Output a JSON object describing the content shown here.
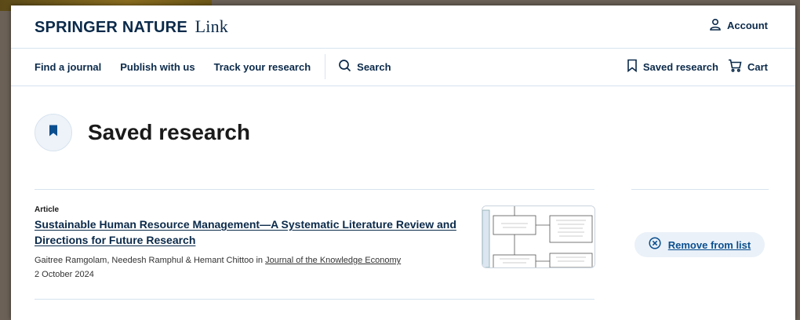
{
  "header": {
    "logo_brand": "SPRINGER NATURE",
    "logo_link": "Link",
    "account_label": "Account"
  },
  "nav": {
    "items": [
      "Find a journal",
      "Publish with us",
      "Track your research"
    ],
    "search_label": "Search",
    "saved_label": "Saved research",
    "cart_label": "Cart"
  },
  "main": {
    "page_title": "Saved research",
    "articles": [
      {
        "type": "Article",
        "title": "Sustainable Human Resource Management—A Systematic Literature Review and Directions for Future Research",
        "authors": "Gaitree Ramgolam, Needesh Ramphul & Hemant Chittoo",
        "in_label": "in",
        "journal": "Journal of the Knowledge Economy",
        "date": "2 October 2024",
        "remove_label": "Remove from list"
      }
    ]
  },
  "colors": {
    "brand_navy": "#0b2a4a",
    "link_blue": "#0b4f8f",
    "divider": "#d7e3ee",
    "button_bg": "#eaf1f8"
  },
  "icons": {
    "account": "person-icon",
    "search": "magnifier-icon",
    "saved": "bookmark-icon",
    "cart": "cart-icon",
    "remove": "circle-x-icon"
  }
}
